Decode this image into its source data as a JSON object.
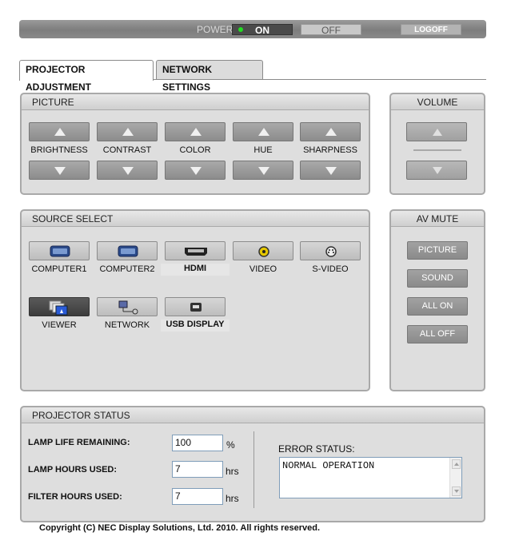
{
  "power": {
    "label": "POWER",
    "on": "ON",
    "off": "OFF",
    "logoff": "LOGOFF"
  },
  "tabs": [
    {
      "label": "PROJECTOR ADJUSTMENT",
      "active": true
    },
    {
      "label": "NETWORK SETTINGS",
      "active": false
    }
  ],
  "picture": {
    "title": "PICTURE",
    "controls": [
      "BRIGHTNESS",
      "CONTRAST",
      "COLOR",
      "HUE",
      "SHARPNESS"
    ]
  },
  "volume": {
    "title": "VOLUME"
  },
  "source": {
    "title": "SOURCE SELECT",
    "items": [
      "COMPUTER1",
      "COMPUTER2",
      "HDMI",
      "VIDEO",
      "S-VIDEO",
      "VIEWER",
      "NETWORK",
      "USB DISPLAY"
    ],
    "selected": "VIEWER"
  },
  "av_mute": {
    "title": "AV MUTE",
    "buttons": [
      "PICTURE",
      "SOUND",
      "ALL ON",
      "ALL OFF"
    ]
  },
  "status": {
    "title": "PROJECTOR STATUS",
    "lamp_life_label": "LAMP LIFE REMAINING:",
    "lamp_life_value": "100",
    "lamp_life_unit": "%",
    "lamp_hours_label": "LAMP HOURS USED:",
    "lamp_hours_value": "7",
    "lamp_hours_unit": "hrs",
    "filter_hours_label": "FILTER HOURS USED:",
    "filter_hours_value": "7",
    "filter_hours_unit": "hrs",
    "error_label": "ERROR STATUS:",
    "error_value": "NORMAL OPERATION"
  },
  "footer": {
    "copyright": "Copyright (C) NEC Display Solutions, Ltd. 2010. All rights reserved."
  },
  "colors": {
    "led_on": "#22dd22",
    "panel_bg": "#dedede",
    "button_gray": "#8c8c8c",
    "selected_source": "#3c3c3c"
  }
}
